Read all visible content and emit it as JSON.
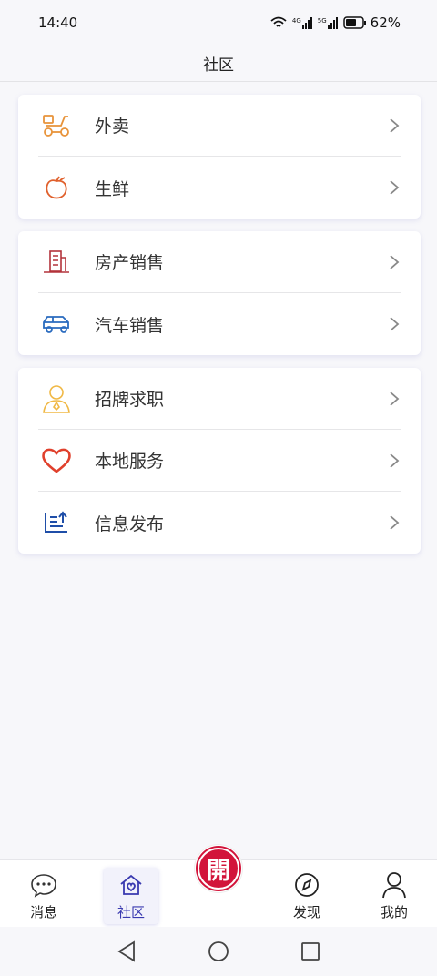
{
  "status": {
    "time": "14:40",
    "battery": "62%",
    "net1": "4G",
    "net2": "5G"
  },
  "header": {
    "title": "社区"
  },
  "groups": [
    [
      {
        "label": "外卖",
        "icon": "scooter-icon"
      },
      {
        "label": "生鲜",
        "icon": "fruit-icon"
      }
    ],
    [
      {
        "label": "房产销售",
        "icon": "building-icon"
      },
      {
        "label": "汽车销售",
        "icon": "car-icon"
      }
    ],
    [
      {
        "label": "招牌求职",
        "icon": "person-icon"
      },
      {
        "label": "本地服务",
        "icon": "heart-icon"
      },
      {
        "label": "信息发布",
        "icon": "publish-icon"
      }
    ]
  ],
  "tabs": {
    "messages": "消息",
    "community": "社区",
    "discover": "发现",
    "mine": "我的"
  },
  "fab": {
    "glyph": "開"
  },
  "colors": {
    "accent": "#3a3ab0",
    "fab": "#d2143a"
  }
}
